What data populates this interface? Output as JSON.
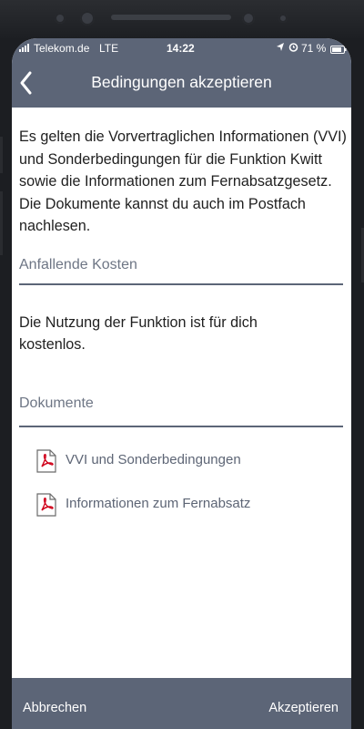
{
  "status_bar": {
    "carrier": "Telekom.de",
    "network": "LTE",
    "time": "14:22",
    "battery": "71 %"
  },
  "header": {
    "title": "Bedingungen akzeptieren",
    "back_icon": "chevron-left-icon"
  },
  "intro_text": "Es gelten die Vorvertraglichen Informationen (VVI) und Sonderbedingungen für die Funktion Kwitt sowie die Informationen zum Fernabsatzgesetz. Die Dokumente kannst du auch im Postfach nachlesen.",
  "costs": {
    "heading": "Anfallende Kosten",
    "text": "Die Nutzung der Funktion ist für dich kostenlos."
  },
  "documents": {
    "heading": "Dokumente",
    "items": [
      {
        "label": "VVI und Sonderbedingungen",
        "icon": "pdf-icon"
      },
      {
        "label": "Informationen zum Fernabsatz",
        "icon": "pdf-icon"
      }
    ]
  },
  "footer": {
    "cancel_label": "Abbrechen",
    "accept_label": "Akzeptieren"
  },
  "colors": {
    "bar": "#5c6577",
    "pdf_red": "#d0021b",
    "muted_text": "#6e7685"
  }
}
